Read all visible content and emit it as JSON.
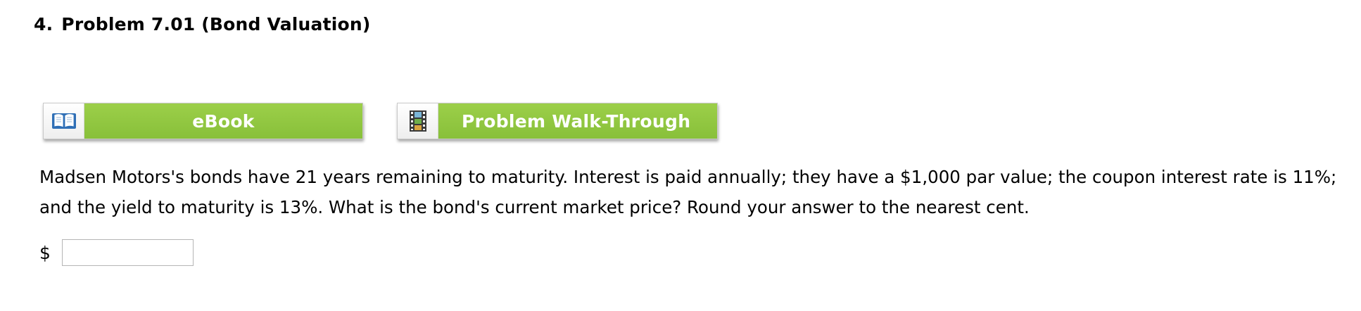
{
  "question": {
    "number": "4.",
    "title": "Problem 7.01 (Bond Valuation)"
  },
  "resources": {
    "ebook": {
      "label": "eBook",
      "icon": "open-book-icon"
    },
    "walkthrough": {
      "label": "Problem Walk-Through",
      "icon": "film-strip-icon"
    }
  },
  "problem": {
    "text": "Madsen Motors's bonds have 21 years remaining to maturity. Interest is paid annually; they have a $1,000 par value; the coupon interest rate is 11%; and the yield to maturity is 13%. What is the bond's current market price? Round your answer to the nearest cent."
  },
  "answer": {
    "currency_symbol": "$",
    "value": ""
  },
  "colors": {
    "button_green": "#8fc640",
    "text": "#000000"
  }
}
